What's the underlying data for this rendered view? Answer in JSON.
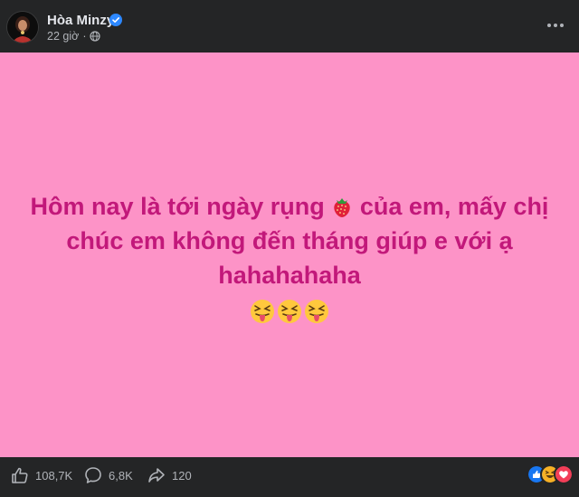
{
  "post": {
    "author": "Hòa Minzy",
    "time": "22 giờ",
    "separator": "·",
    "privacy_icon": "globe-icon",
    "verified_icon": "verified-badge-icon",
    "more_icon": "more-options-icon",
    "text_line1_a": "Hôm nay là tới ngày rụng",
    "text_line1_b": "của em, mấy chị",
    "text_line2": "chúc em không đến tháng giúp e với ạ",
    "text_line3": "hahahahaha",
    "inline_emoji": "strawberry-icon",
    "trailing_emoji": [
      "squinting-tongue-icon",
      "squinting-tongue-icon",
      "squinting-tongue-icon"
    ]
  },
  "colors": {
    "background": "#fd93c7",
    "text": "#c2187a",
    "surface": "#242526",
    "secondary_text": "#b0b3b8"
  },
  "footer": {
    "likes": "108,7K",
    "comments": "6,8K",
    "shares": "120",
    "reaction_icons": [
      "like-reaction-icon",
      "haha-reaction-icon",
      "love-reaction-icon"
    ]
  }
}
